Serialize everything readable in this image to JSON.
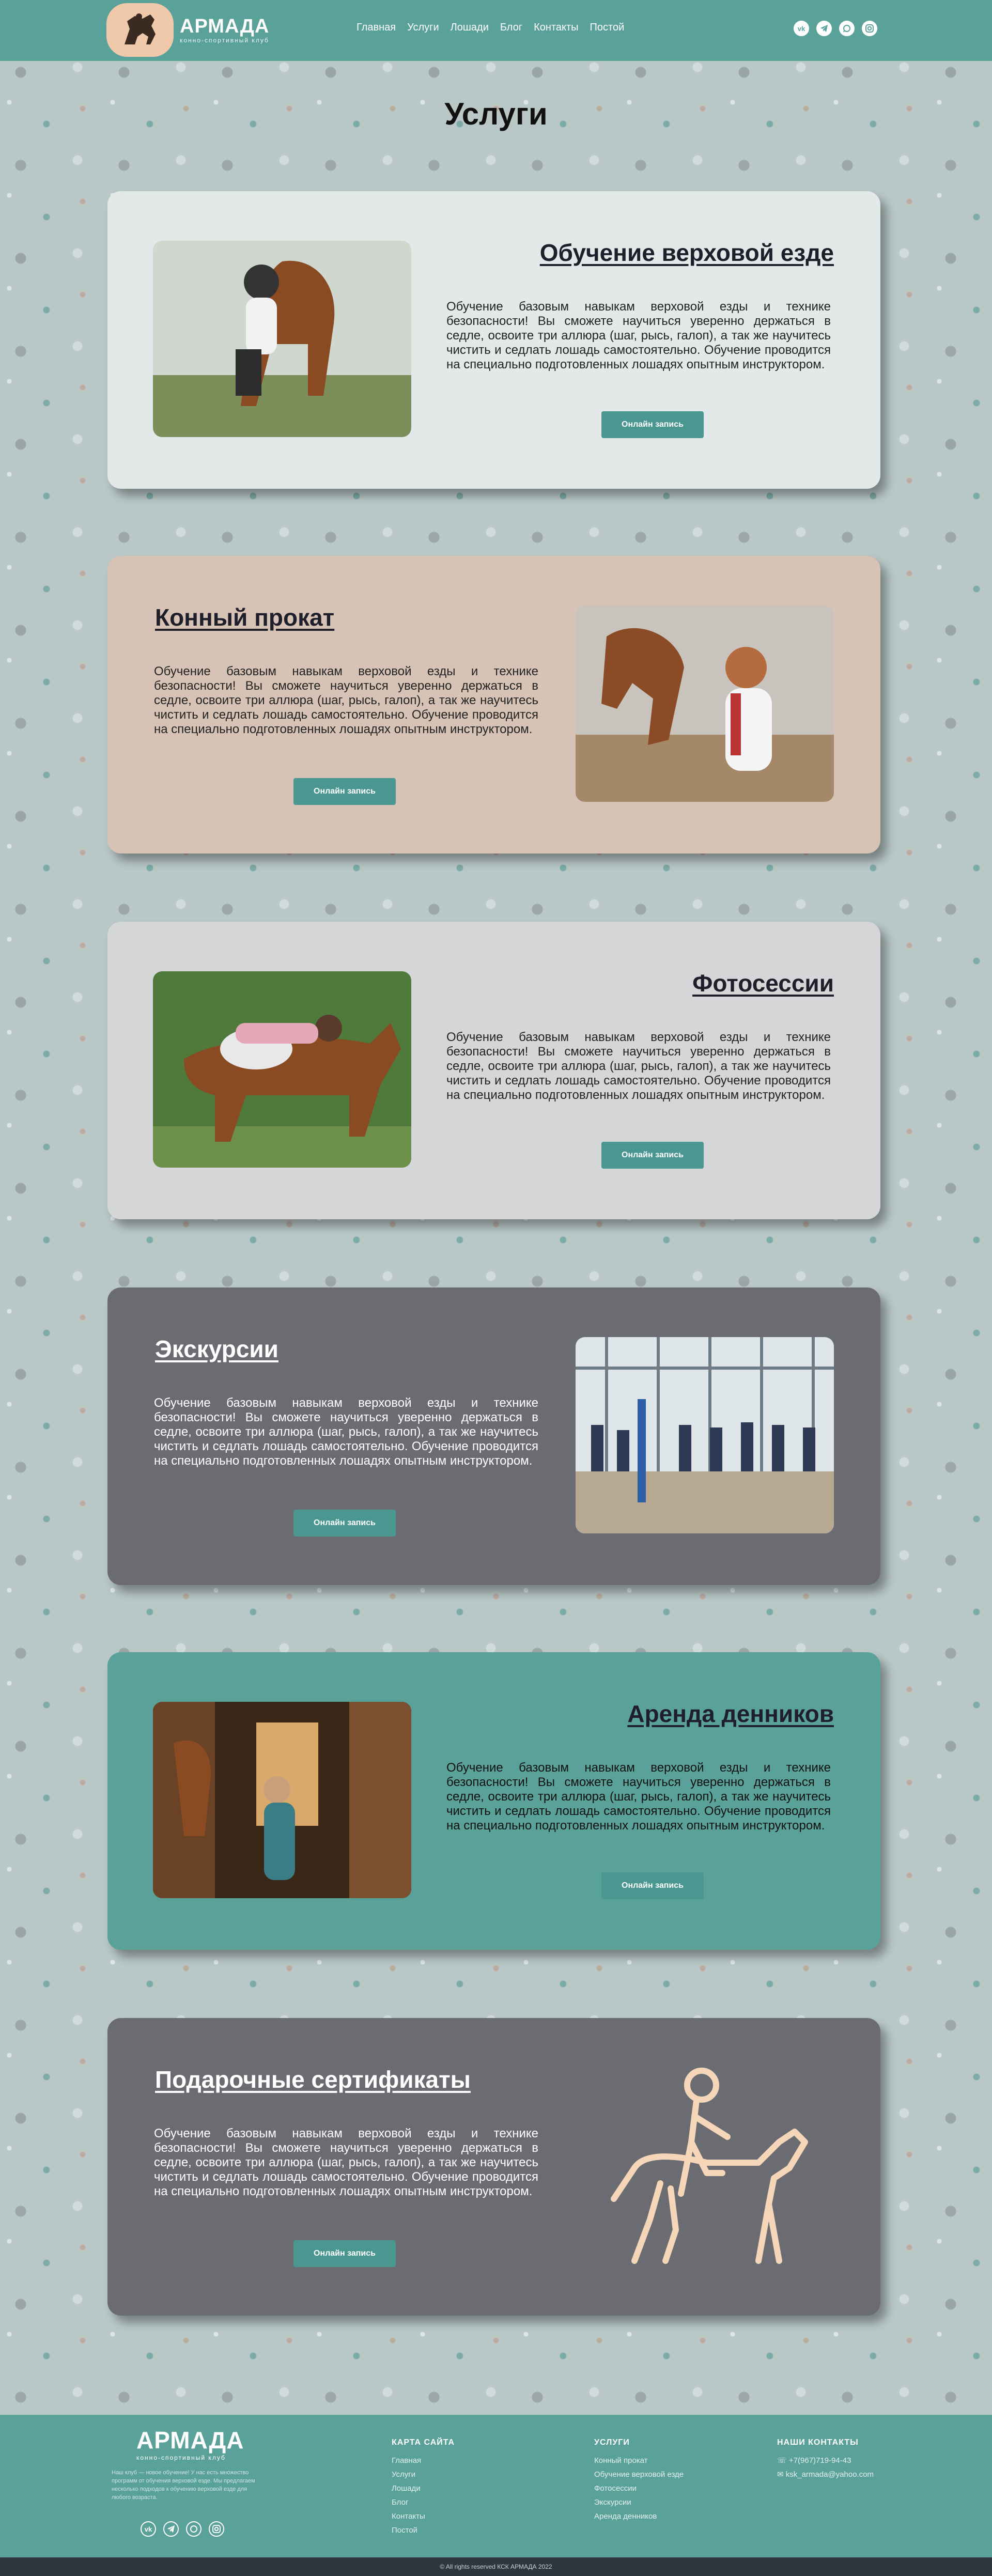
{
  "header": {
    "brand": "АРМАДА",
    "brand_sub": "конно-спортивный клуб",
    "nav": [
      "Главная",
      "Услуги",
      "Лошади",
      "Блог",
      "Контакты",
      "Постой"
    ]
  },
  "socials": [
    "vk-icon",
    "telegram-icon",
    "whatsapp-icon",
    "instagram-icon"
  ],
  "page": {
    "title": "Услуги"
  },
  "services": [
    {
      "title": "Обучение верховой езде",
      "text": "Обучение базовым навыкам верховой езды и технике безопасности! Вы сможете научиться уверенно держаться в седле, освоите три аллюра (шаг, рысь, галоп), а так же научитесь чистить и седлать лошадь самостоятельно. Обучение проводится на специально подготовленных лошадях опытным инструктором.",
      "button": "Онлайн запись"
    },
    {
      "title": "Конный прокат",
      "text": "Обучение базовым навыкам верховой езды и технике безопасности! Вы сможете научиться уверенно держаться в седле, освоите три аллюра (шаг, рысь, галоп), а так же научитесь чистить и седлать лошадь самостоятельно. Обучение проводится на специально подготовленных лошадях опытным инструктором.",
      "button": "Онлайн запись"
    },
    {
      "title": "Фотосессии",
      "text": "Обучение базовым навыкам верховой езды и технике безопасности! Вы сможете научиться уверенно держаться в седле, освоите три аллюра (шаг, рысь, галоп), а так же научитесь чистить и седлать лошадь самостоятельно. Обучение проводится на специально подготовленных лошадях опытным инструктором.",
      "button": "Онлайн запись"
    },
    {
      "title": "Экскурсии",
      "text": "Обучение базовым навыкам верховой езды и технике безопасности! Вы сможете научиться уверенно держаться в седле, освоите три аллюра (шаг, рысь, галоп), а так же научитесь чистить и седлать лошадь самостоятельно. Обучение проводится на специально подготовленных лошадях опытным инструктором.",
      "button": "Онлайн запись"
    },
    {
      "title": "Аренда денников",
      "text": "Обучение базовым навыкам верховой езды и технике безопасности! Вы сможете научиться уверенно держаться в седле, освоите три аллюра (шаг, рысь, галоп), а так же научитесь чистить и седлать лошадь самостоятельно. Обучение проводится на специально подготовленных лошадях опытным инструктором.",
      "button": "Онлайн запись"
    },
    {
      "title": "Подарочные сертификаты",
      "text": "Обучение базовым навыкам верховой езды и технике безопасности! Вы сможете научиться уверенно держаться в седле, освоите три аллюра (шаг, рысь, галоп), а так же научитесь чистить и седлать лошадь самостоятельно. Обучение проводится на специально подготовленных лошадях опытным инструктором.",
      "button": "Онлайн запись"
    }
  ],
  "footer": {
    "brand": "АРМАДА",
    "brand_sub": "конно-спортивный клуб",
    "description": "Наш клуб — новое обучение! У нас есть множество программ от обучения верховой езде. Мы предлагаем несколько подходов к обучению верховой езде для любого возраста.",
    "sitemap_title": "КАРТА САЙТА",
    "sitemap": [
      "Главная",
      "Услуги",
      "Лошади",
      "Блог",
      "Контакты",
      "Постой"
    ],
    "services_title": "УСЛУГИ",
    "services": [
      "Конный прокат",
      "Обучение верховой езде",
      "Фотосессии",
      "Экскурсии",
      "Аренда денников"
    ],
    "contacts_title": "НАШИ КОНТАКТЫ",
    "phone": "+7(967)719-94-43",
    "email": "ksk_armada@yahoo.com",
    "copyright": "© All rights reserved КСК АРМАДА 2022"
  }
}
